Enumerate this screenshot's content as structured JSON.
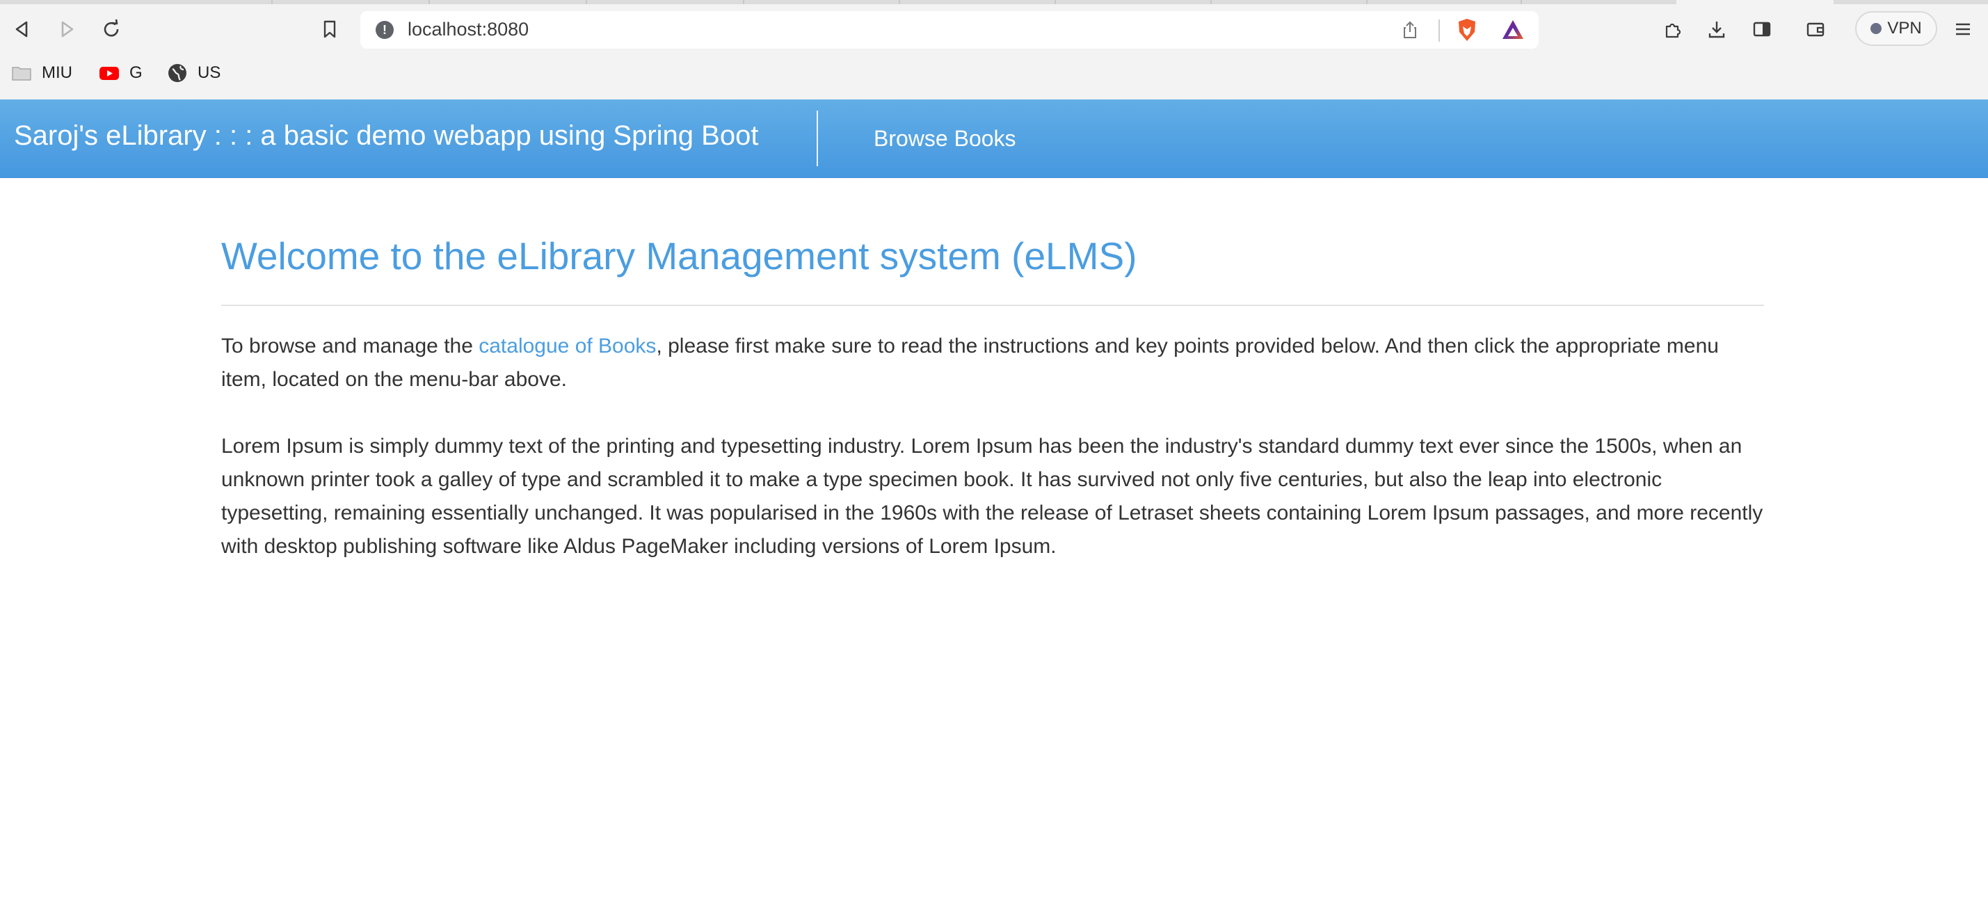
{
  "browser": {
    "url": "localhost:8080",
    "vpn_label": "VPN",
    "bookmarks": [
      {
        "label": "MIU",
        "icon": "folder-icon"
      },
      {
        "label": "G",
        "icon": "youtube-icon"
      },
      {
        "label": "US",
        "icon": "globe-icon"
      }
    ]
  },
  "navbar": {
    "brand": "Saroj's eLibrary : : : a basic demo webapp using Spring Boot",
    "links": [
      {
        "label": "Browse Books"
      }
    ]
  },
  "main": {
    "heading": "Welcome to the eLibrary Management system (eLMS)",
    "intro_before_link": "To browse and manage the ",
    "intro_link": "catalogue of Books",
    "intro_after_link": ", please first make sure to read the instructions and key points provided below. And then click the appropriate menu item, located on the menu-bar above.",
    "lorem": "Lorem Ipsum is simply dummy text of the printing and typesetting industry. Lorem Ipsum has been the industry's standard dummy text ever since the 1500s, when an unknown printer took a galley of type and scrambled it to make a type specimen book. It has survived not only five centuries, but also the leap into electronic typesetting, remaining essentially unchanged. It was popularised in the 1960s with the release of Letraset sheets containing Lorem Ipsum passages, and more recently with desktop publishing software like Aldus PageMaker including versions of Lorem Ipsum."
  },
  "colors": {
    "navbar_top": "#62aee6",
    "navbar_bottom": "#4597df",
    "heading": "#4b9de0",
    "link": "#4b9de0"
  }
}
